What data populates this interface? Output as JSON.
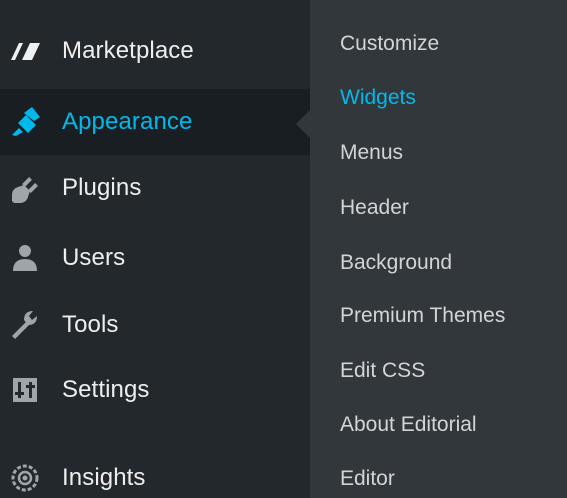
{
  "menu": {
    "items": [
      {
        "label": "Marketplace",
        "icon": "marketplace-icon"
      },
      {
        "label": "Appearance",
        "icon": "paintbrush-icon",
        "active": true
      },
      {
        "label": "Plugins",
        "icon": "plugin-icon"
      },
      {
        "label": "Users",
        "icon": "users-icon"
      },
      {
        "label": "Tools",
        "icon": "wrench-icon"
      },
      {
        "label": "Settings",
        "icon": "settings-icon"
      },
      {
        "label": "Insights",
        "icon": "insights-icon"
      }
    ]
  },
  "submenu": {
    "items": [
      {
        "label": "Customize"
      },
      {
        "label": "Widgets",
        "current": true
      },
      {
        "label": "Menus"
      },
      {
        "label": "Header"
      },
      {
        "label": "Background"
      },
      {
        "label": "Premium Themes"
      },
      {
        "label": "Edit CSS"
      },
      {
        "label": "About Editorial"
      },
      {
        "label": "Editor"
      }
    ]
  },
  "colors": {
    "menu_background": "#23282d",
    "active_background": "#191e23",
    "submenu_background": "#32373c",
    "accent": "#00b9eb",
    "text": "#eeeeee"
  }
}
